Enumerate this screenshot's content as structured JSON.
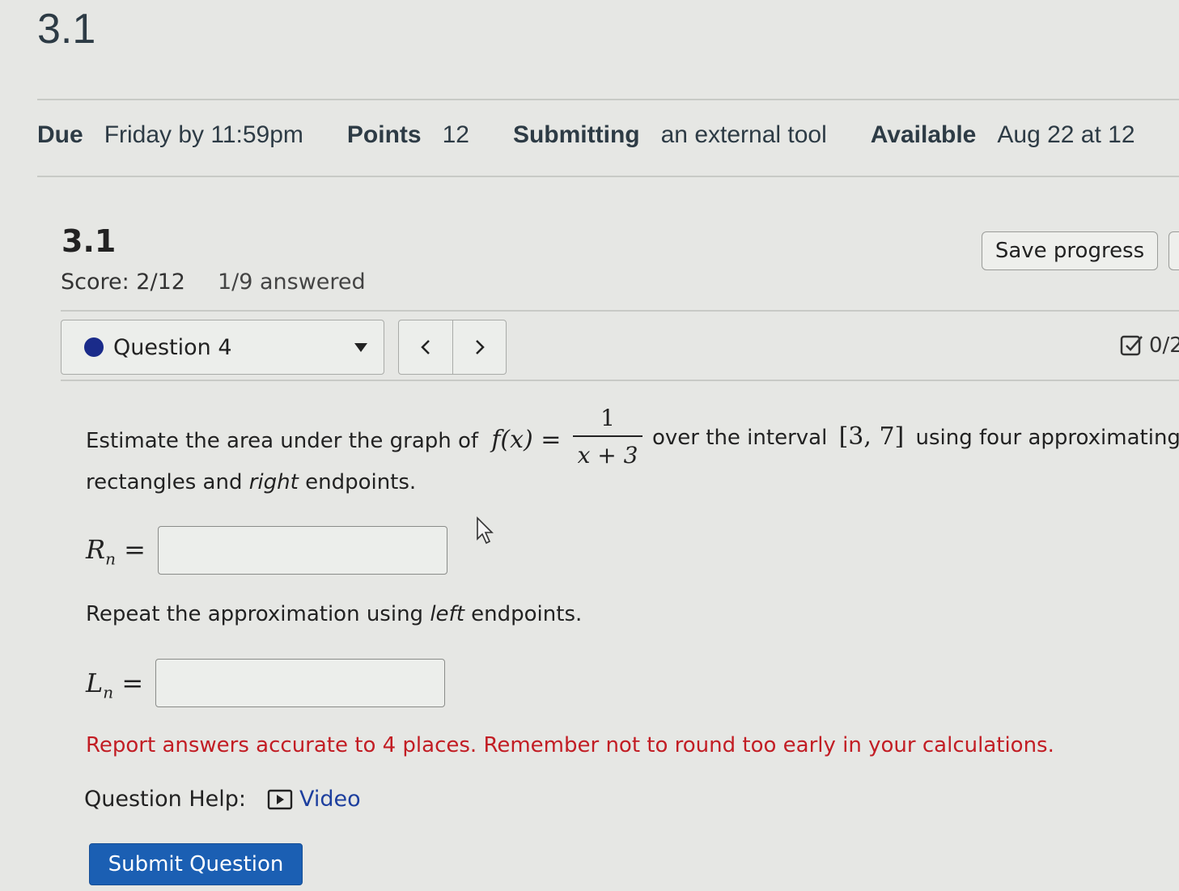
{
  "page": {
    "title": "3.1"
  },
  "details": {
    "due_label": "Due",
    "due_value": "Friday by 11:59pm",
    "points_label": "Points",
    "points_value": "12",
    "submitting_label": "Submitting",
    "submitting_value": "an external tool",
    "available_label": "Available",
    "available_value": "Aug 22 at 12"
  },
  "quiz": {
    "title": "3.1",
    "score": "Score: 2/12",
    "answered": "1/9 answered",
    "save_label": "Save progress",
    "question_selector": "Question 4",
    "grade": "0/2"
  },
  "question": {
    "intro": "Estimate the area under the graph of",
    "func": "f(x) =",
    "numerator": "1",
    "denominator": "x + 3",
    "mid": "over the interval",
    "interval": "[3, 7]",
    "tail": "using four approximating",
    "line2_a": "rectangles and",
    "line2_em": "right",
    "line2_b": "endpoints.",
    "rn_symbol": "R",
    "rn_sub": "n",
    "eq_sign": "=",
    "repeat_a": "Repeat the approximation using",
    "repeat_em": "left",
    "repeat_b": "endpoints.",
    "ln_symbol": "L",
    "ln_sub": "n",
    "rn_value": "",
    "ln_value": "",
    "warning": "Report answers accurate to 4 places. Remember not to round too early in your calculations.",
    "help_label": "Question Help:",
    "video_label": "Video",
    "submit_label": "Submit Question"
  },
  "colors": {
    "warning": "#c21d24",
    "link": "#1d3f9e",
    "submit_bg": "#1b5fb3",
    "question_dot": "#1a2b8a"
  },
  "icons": [
    "chevron-left-icon",
    "chevron-right-icon",
    "caret-down-icon",
    "checkbox-icon",
    "video-icon",
    "mouse-cursor-icon"
  ]
}
